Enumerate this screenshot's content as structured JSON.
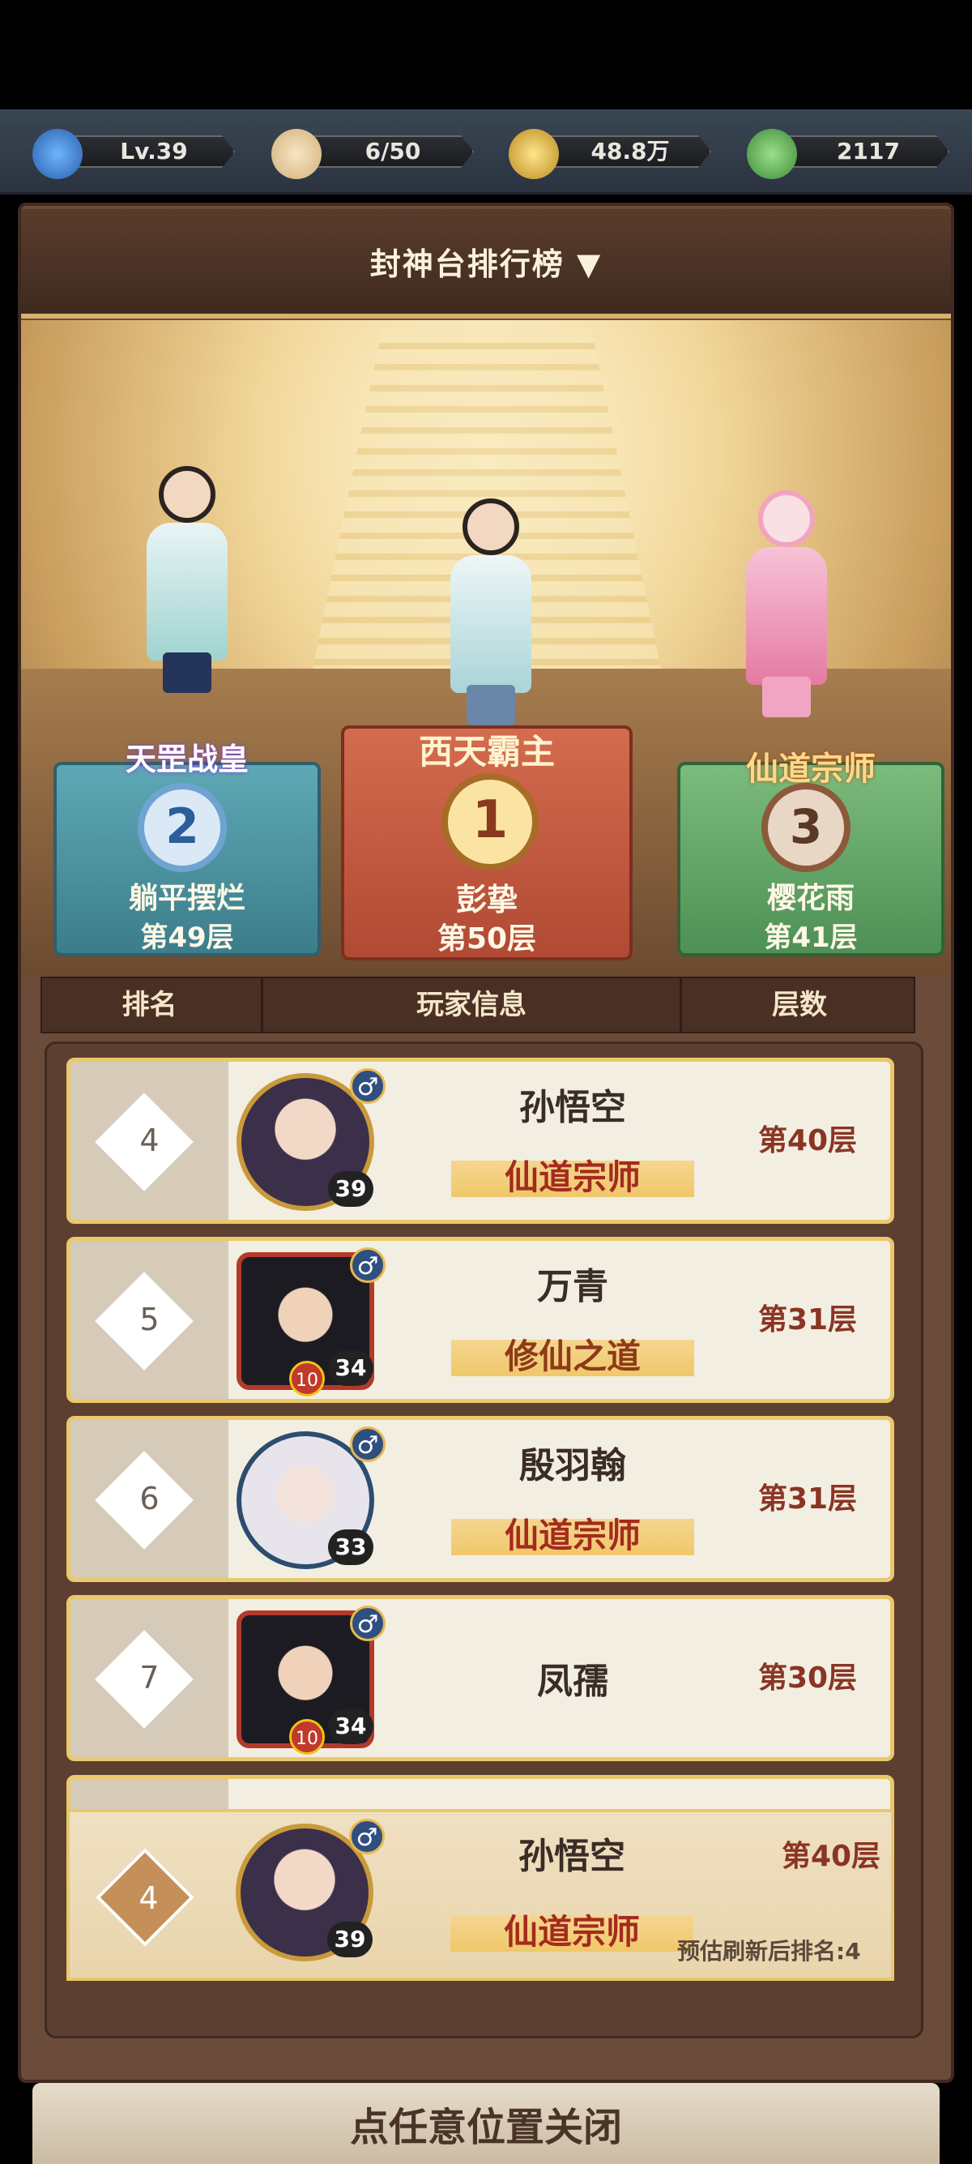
{
  "resources": [
    {
      "icon": "level-icon",
      "value": "Lv.39"
    },
    {
      "icon": "bun-stamina-icon",
      "value": "6/50"
    },
    {
      "icon": "coin-icon",
      "value": "48.8万"
    },
    {
      "icon": "jade-leaf-icon",
      "value": "2117"
    }
  ],
  "title": "封神台排行榜",
  "title_arrow": "▼",
  "podium": [
    {
      "rank": "1",
      "honor": "西天霸主",
      "name": "彭挚",
      "floor": "第50层"
    },
    {
      "rank": "2",
      "honor": "天罡战皇",
      "name": "躺平摆烂",
      "floor": "第49层"
    },
    {
      "rank": "3",
      "honor": "仙道宗师",
      "name": "樱花雨",
      "floor": "第41层"
    }
  ],
  "columns": {
    "rank": "排名",
    "info": "玩家信息",
    "floors": "层数"
  },
  "rows": [
    {
      "rank": "4",
      "name": "孙悟空",
      "title": "仙道宗师",
      "level": "39",
      "floor": "第40层",
      "gender": "♂"
    },
    {
      "rank": "5",
      "name": "万青",
      "title": "修仙之道",
      "level": "34",
      "badge": "10",
      "floor": "第31层",
      "gender": "♂"
    },
    {
      "rank": "6",
      "name": "殷羽翰",
      "title": "仙道宗师",
      "level": "33",
      "floor": "第31层",
      "gender": "♂"
    },
    {
      "rank": "7",
      "name": "凤孺",
      "level": "34",
      "badge": "10",
      "floor": "第30层",
      "gender": "♂"
    }
  ],
  "me": {
    "rank": "4",
    "name": "孙悟空",
    "title": "仙道宗师",
    "level": "39",
    "floor": "第40层",
    "gender": "♂",
    "estimate": "预估刷新后排名:4"
  },
  "close_hint": "点任意位置关闭"
}
